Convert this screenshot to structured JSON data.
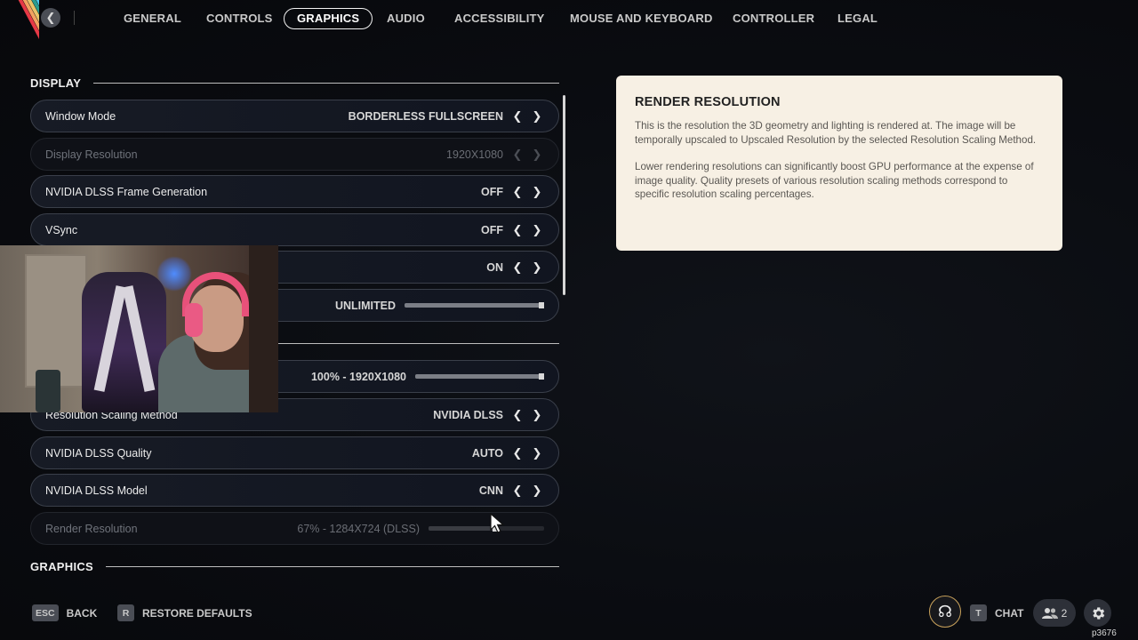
{
  "nav": {
    "tabs": [
      {
        "label": "GENERAL",
        "active": false
      },
      {
        "label": "CONTROLS",
        "active": false
      },
      {
        "label": "GRAPHICS",
        "active": true
      },
      {
        "label": "AUDIO",
        "active": false
      },
      {
        "label": "ACCESSIBILITY",
        "active": false
      },
      {
        "label": "MOUSE AND KEYBOARD",
        "active": false
      },
      {
        "label": "CONTROLLER",
        "active": false
      },
      {
        "label": "LEGAL",
        "active": false
      }
    ]
  },
  "sections": {
    "display": "DISPLAY",
    "graphics": "GRAPHICS"
  },
  "settings": [
    {
      "label": "Window Mode",
      "value": "BORDERLESS FULLSCREEN",
      "control": "arrows",
      "disabled": false
    },
    {
      "label": "Display Resolution",
      "value": "1920X1080",
      "control": "arrows",
      "disabled": true
    },
    {
      "label": "NVIDIA DLSS Frame Generation",
      "value": "OFF",
      "control": "arrows",
      "disabled": false
    },
    {
      "label": "VSync",
      "value": "OFF",
      "control": "arrows",
      "disabled": false
    },
    {
      "label": "",
      "value": "ON",
      "control": "arrows",
      "disabled": false
    },
    {
      "label": "",
      "value": "UNLIMITED",
      "control": "slider",
      "slider_level": 1.0,
      "disabled": false
    },
    {
      "label": "",
      "value": "100% - 1920X1080",
      "control": "slider",
      "slider_level": 1.0,
      "disabled": false
    },
    {
      "label": "Resolution Scaling Method",
      "value": "NVIDIA DLSS",
      "control": "arrows",
      "disabled": false
    },
    {
      "label": "NVIDIA DLSS Quality",
      "value": "AUTO",
      "control": "arrows",
      "disabled": false
    },
    {
      "label": "NVIDIA DLSS Model",
      "value": "CNN",
      "control": "arrows",
      "disabled": false
    },
    {
      "label": "Render Resolution",
      "value": "67% - 1284X724 (DLSS)",
      "control": "slider",
      "slider_level": 0.6,
      "disabled": true
    }
  ],
  "info": {
    "title": "RENDER RESOLUTION",
    "para1": "This is the resolution the 3D geometry and lighting is rendered at. The image will be temporally upscaled to Upscaled Resolution by the selected Resolution Scaling Method.",
    "para2": "Lower rendering resolutions can significantly boost GPU performance at the expense of image quality. Quality presets of various resolution scaling methods correspond to specific resolution scaling percentages."
  },
  "bottom": {
    "back_key": "ESC",
    "back_label": "BACK",
    "restore_key": "R",
    "restore_label": "RESTORE DEFAULTS",
    "chat_key": "T",
    "chat_label": "CHAT",
    "friends_count": "2",
    "build": "p3676"
  },
  "icons": {
    "back": "chevron-left-icon",
    "arrow_left": "chevron-left-icon",
    "arrow_right": "chevron-right-icon",
    "friends": "people-icon",
    "settings": "gear-icon",
    "emblem": "game-emblem-icon"
  },
  "colors": {
    "accent_panel": "#f7f0e4",
    "background": "#0b0d12",
    "emblem_ring": "#c9a25b"
  }
}
